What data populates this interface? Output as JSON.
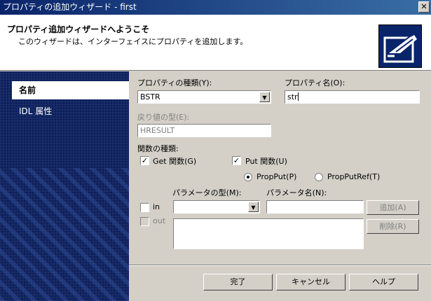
{
  "window": {
    "title": "プロパティの追加ウィザード - first",
    "close_label": "✕"
  },
  "header": {
    "title": "プロパティ追加ウィザードへようこそ",
    "subtitle": "このウィザードは、インターフェイスにプロパティを追加します。",
    "icon": "wizard-hand-icon"
  },
  "sidebar": {
    "items": [
      {
        "label": "名前",
        "active": true
      },
      {
        "label": "IDL 属性",
        "active": false
      }
    ]
  },
  "form": {
    "property_type_label": "プロパティの種類(Y):",
    "property_type_value": "BSTR",
    "property_name_label": "プロパティ名(O):",
    "property_name_value": "str",
    "return_type_label": "戻り値の型(E):",
    "return_type_value": "HRESULT",
    "function_type_label": "関数の種類:",
    "get_label": "Get 関数(G)",
    "get_checked": true,
    "put_label": "Put 関数(U)",
    "put_checked": true,
    "propput_label": "PropPut(P)",
    "propputref_label": "PropPutRef(T)",
    "param_type_label": "パラメータの型(M):",
    "param_name_label": "パラメータ名(N):",
    "in_label": "in",
    "out_label": "out",
    "add_label": "追加(A)",
    "delete_label": "削除(R)"
  },
  "footer": {
    "finish_label": "完了",
    "cancel_label": "キャンセル",
    "help_label": "ヘルプ"
  },
  "colors": {
    "title_start": "#0a246a",
    "title_end": "#3a6ea5",
    "sidebar": "#0a1e5c",
    "face": "#d4d0c8"
  }
}
